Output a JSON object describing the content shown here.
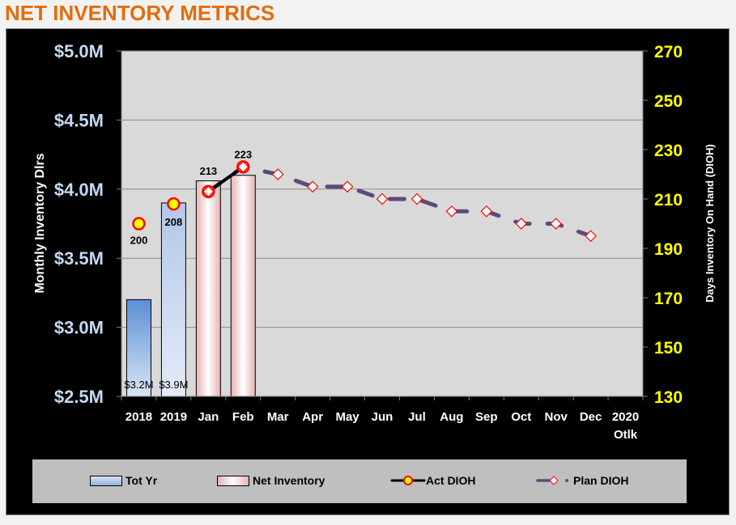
{
  "page_title": "NET INVENTORY METRICS",
  "colors": {
    "title": "#e46c0a",
    "left_tick": "#c5d9f1",
    "right_tick": "#ffff00",
    "plot_bg": "#d9d9d9",
    "plan_line": "#5f497a"
  },
  "chart_data": {
    "type": "bar",
    "title": "NET INVENTORY METRICS",
    "categories": [
      "2018",
      "2019",
      "Jan",
      "Feb",
      "Mar",
      "Apr",
      "May",
      "Jun",
      "Jul",
      "Aug",
      "Sep",
      "Oct",
      "Nov",
      "Dec",
      "2020 Otlk"
    ],
    "ylabel": "Monthly Inventory Dlrs",
    "y2label": "Days Inventory On Hand (DIOH)",
    "ylim": [
      2.5,
      5.0
    ],
    "y2lim": [
      130,
      270
    ],
    "yticks": [
      "$2.5M",
      "$3.0M",
      "$3.5M",
      "$4.0M",
      "$4.5M",
      "$5.0M"
    ],
    "y2ticks": [
      "130",
      "150",
      "170",
      "190",
      "210",
      "230",
      "250",
      "270"
    ],
    "grid": true,
    "legend_position": "bottom",
    "series": [
      {
        "name": "Tot Yr",
        "type": "bar",
        "axis": "left",
        "values": [
          3.2,
          3.9,
          null,
          null,
          null,
          null,
          null,
          null,
          null,
          null,
          null,
          null,
          null,
          null,
          null
        ],
        "labels": [
          "$3.2M",
          "$3.9M"
        ]
      },
      {
        "name": "Net Inventory",
        "type": "bar",
        "axis": "left",
        "values": [
          null,
          null,
          4.06,
          4.1,
          null,
          null,
          null,
          null,
          null,
          null,
          null,
          null,
          null,
          null,
          null
        ]
      },
      {
        "name": "Act DIOH",
        "type": "line",
        "axis": "right",
        "values": [
          200,
          208,
          213,
          223,
          null,
          null,
          null,
          null,
          null,
          null,
          null,
          null,
          null,
          null,
          null
        ],
        "labels": [
          "200",
          "208",
          "213",
          "223"
        ]
      },
      {
        "name": "Plan DIOH",
        "type": "line",
        "axis": "right",
        "values": [
          null,
          null,
          213,
          223,
          220,
          215,
          215,
          210,
          210,
          205,
          205,
          200,
          200,
          195,
          null
        ]
      }
    ]
  },
  "legend": [
    {
      "label": "Tot Yr"
    },
    {
      "label": "Net Inventory"
    },
    {
      "label": "Act DIOH"
    },
    {
      "label": "Plan DIOH"
    }
  ]
}
